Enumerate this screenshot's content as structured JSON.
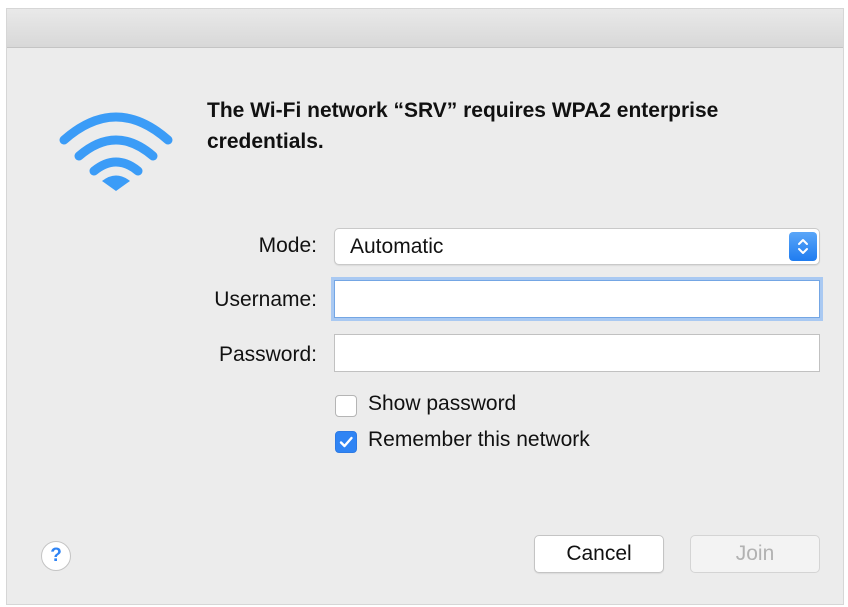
{
  "dialog": {
    "headline": "The Wi-Fi network “SRV” requires WPA2 enterprise credentials."
  },
  "form": {
    "mode_label": "Mode:",
    "mode_value": "Automatic",
    "username_label": "Username:",
    "username_value": "",
    "password_label": "Password:",
    "password_value": ""
  },
  "options": {
    "show_password": {
      "label": "Show password",
      "checked": false
    },
    "remember_network": {
      "label": "Remember this network",
      "checked": true
    }
  },
  "buttons": {
    "help_label": "?",
    "cancel_label": "Cancel",
    "join_label": "Join"
  },
  "colors": {
    "accent": "#2f84f4",
    "wifi_icon": "#3b9cf7",
    "disabled_text": "#b2b2b2"
  },
  "icons": {
    "wifi": "wifi-icon",
    "popup_arrows": "up-down-chevron-icon",
    "checkmark": "checkmark-icon"
  }
}
